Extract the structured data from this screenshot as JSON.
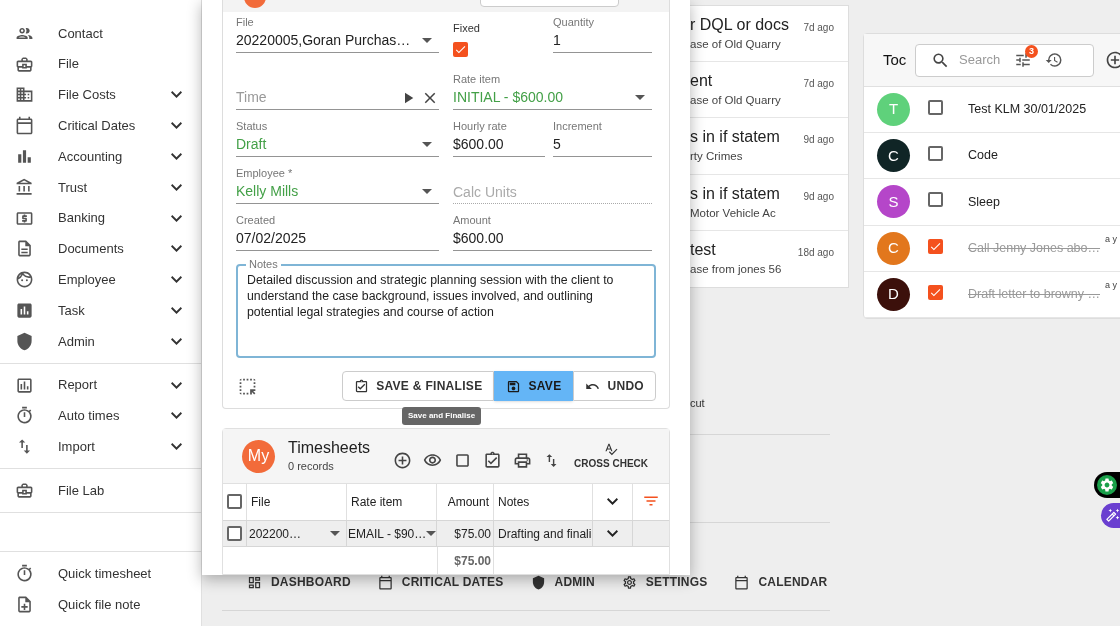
{
  "sidebar": {
    "groups": [
      {
        "items": [
          {
            "label": "Contact",
            "has_menu": false
          },
          {
            "label": "File",
            "has_menu": false
          },
          {
            "label": "File Costs",
            "has_menu": true
          },
          {
            "label": "Critical Dates",
            "has_menu": true
          },
          {
            "label": "Accounting",
            "has_menu": true
          },
          {
            "label": "Trust",
            "has_menu": true
          },
          {
            "label": "Banking",
            "has_menu": true
          },
          {
            "label": "Documents",
            "has_menu": true
          },
          {
            "label": "Employee",
            "has_menu": true
          },
          {
            "label": "Task",
            "has_menu": true
          },
          {
            "label": "Admin",
            "has_menu": true
          }
        ]
      },
      {
        "items": [
          {
            "label": "Report",
            "has_menu": true
          },
          {
            "label": "Auto times",
            "has_menu": true
          },
          {
            "label": "Import",
            "has_menu": true
          }
        ]
      },
      {
        "items": [
          {
            "label": "File Lab",
            "has_menu": false
          }
        ]
      },
      {
        "items": [
          {
            "label": "Quick timesheet",
            "has_menu": false
          },
          {
            "label": "Quick file note",
            "has_menu": false
          }
        ]
      }
    ]
  },
  "entry_form": {
    "file": {
      "label": "File",
      "value": "20220005,Goran Purchas…"
    },
    "fixed": {
      "label": "Fixed",
      "checked": true
    },
    "quantity": {
      "label": "Quantity",
      "value": "1"
    },
    "time": {
      "placeholder": "Time"
    },
    "rate_item": {
      "label": "Rate item",
      "value": "INITIAL - $600.00"
    },
    "status": {
      "label": "Status",
      "value": "Draft"
    },
    "hourly_rate": {
      "label": "Hourly rate",
      "value": "$600.00"
    },
    "increment": {
      "label": "Increment",
      "value": "5"
    },
    "employee": {
      "label": "Employee *",
      "value": "Kelly Mills"
    },
    "calc_units": {
      "placeholder": "Calc Units",
      "disabled": true
    },
    "created": {
      "label": "Created",
      "value": "07/02/2025"
    },
    "amount": {
      "label": "Amount",
      "value": "$600.00"
    },
    "notes": {
      "label": "Notes",
      "value": "Detailed discussion and strategic planning session with the client to understand the case background, issues involved, and outlining potential legal strategies and course of action"
    },
    "buttons": [
      {
        "label": "SAVE & FINALISE",
        "kind": "outline"
      },
      {
        "label": "SAVE",
        "kind": "primary"
      },
      {
        "label": "UNDO",
        "kind": "outline"
      }
    ],
    "tooltip": "Save and Finalise"
  },
  "timesheets": {
    "avatar": "My",
    "title": "Timesheets",
    "subtitle": "0 records",
    "cross_check": "CROSS CHECK",
    "select_all_checked": false,
    "columns": [
      {
        "label": "File"
      },
      {
        "label": "Rate item"
      },
      {
        "label": "Amount"
      },
      {
        "label": "Notes"
      }
    ],
    "rows": [
      {
        "checked": false,
        "file": "202200…",
        "rate_item": "EMAIL - $90…",
        "amount": "$75.00",
        "notes": "Drafting and finali"
      }
    ],
    "total": "$75.00"
  },
  "notes_list": [
    {
      "title": "r DQL or docs",
      "subtitle": "ase of Old Quarry",
      "time": "7d ago"
    },
    {
      "title": "ent",
      "subtitle": "ase of Old Quarry",
      "time": "7d ago"
    },
    {
      "title": "s in if statem",
      "subtitle": "rty Crimes",
      "time": "9d ago"
    },
    {
      "title": "s in if statem",
      "subtitle": "Motor Vehicle Ac",
      "time": "9d ago"
    },
    {
      "title": "test",
      "subtitle": "ase from jones 56",
      "time": "18d ago"
    }
  ],
  "note_fragment": "cut",
  "quick_links": [
    {
      "label": "DASHBOARD"
    },
    {
      "label": "CRITICAL DATES"
    },
    {
      "label": "ADMIN"
    },
    {
      "label": "SETTINGS"
    },
    {
      "label": "CALENDAR"
    }
  ],
  "todo": {
    "title": "Toc",
    "search_placeholder": "Search",
    "filter_count": "3",
    "items": [
      {
        "avatar": "T",
        "color": "#5fd17b",
        "checked": false,
        "text": "Test KLM 30/01/2025"
      },
      {
        "avatar": "C",
        "color": "#102526",
        "checked": false,
        "text": "Code"
      },
      {
        "avatar": "S",
        "color": "#b546c9",
        "checked": false,
        "text": "Sleep"
      },
      {
        "avatar": "C",
        "color": "#e2771d",
        "checked": true,
        "text": "Call Jenny Jones abo…",
        "time": "a y"
      },
      {
        "avatar": "D",
        "color": "#3c100b",
        "checked": true,
        "text": "Draft letter to browny …",
        "time": "a y"
      }
    ]
  }
}
